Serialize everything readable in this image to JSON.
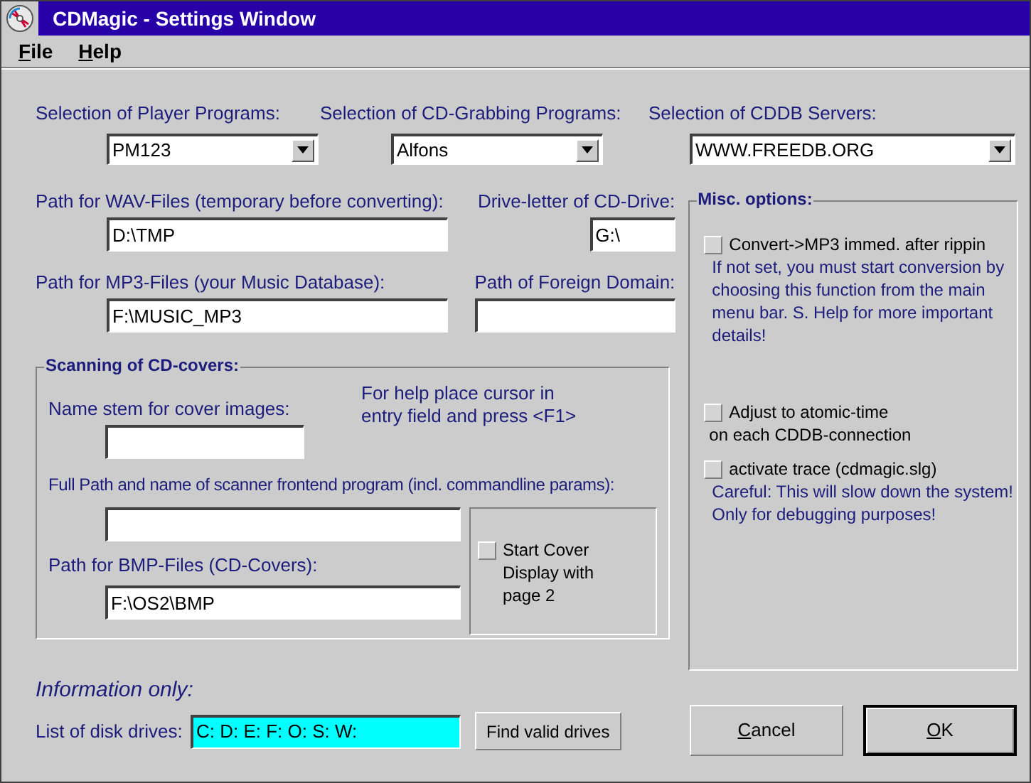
{
  "window": {
    "title": "CDMagic - Settings Window"
  },
  "menu": [
    {
      "label": "File"
    },
    {
      "label": "Help"
    }
  ],
  "selections": [
    {
      "label": "Selection of Player Programs:",
      "value": "PM123"
    },
    {
      "label": "Selection of CD-Grabbing Programs:",
      "value": "Alfons"
    },
    {
      "label": "Selection of CDDB Servers:",
      "value": "WWW.FREEDB.ORG"
    }
  ],
  "paths": {
    "wav": {
      "label": "Path for WAV-Files (temporary before converting):",
      "value": "D:\\TMP"
    },
    "drive": {
      "label": "Drive-letter of CD-Drive:",
      "value": "G:\\"
    },
    "mp3": {
      "label": "Path for MP3-Files (your Music Database):",
      "value": "F:\\MUSIC_MP3"
    },
    "foreign": {
      "label": "Path of Foreign Domain:"
    }
  },
  "scanning": {
    "title": "Scanning of CD-covers:",
    "name_stem_label": "Name stem for cover images:",
    "hint": "For help place cursor in entry field and press <F1>",
    "scanner_label": "Full Path and name of scanner frontend program (incl. commandline params):",
    "bmp_label": "Path for BMP-Files (CD-Covers):",
    "bmp_value": "F:\\OS2\\BMP",
    "start_cover": {
      "label": "Start Cover Display with page 2",
      "checked": false
    }
  },
  "misc_options": {
    "title": "Misc. options:",
    "options": [
      {
        "label": "Convert->MP3 immed. after rippin",
        "checked": false,
        "note": "If not set, you must start conversion by choosing this function from the main menu bar. S. Help for more important details!"
      },
      {
        "label": "Adjust to atomic-time",
        "label_continued": "on each CDDB-connection",
        "checked": false
      },
      {
        "label": "activate trace (cdmagic.slg)",
        "checked": false,
        "note": "Careful: This will slow down the system! Only for debugging purposes!"
      }
    ]
  },
  "information": {
    "heading": "Information only:",
    "drives_label": "List of disk drives:",
    "drives_value": "C: D: E: F: O: S: W:",
    "find_button": "Find valid drives"
  },
  "buttons": [
    {
      "label": "Cancel",
      "default": false
    },
    {
      "label": "OK",
      "default": true
    }
  ]
}
